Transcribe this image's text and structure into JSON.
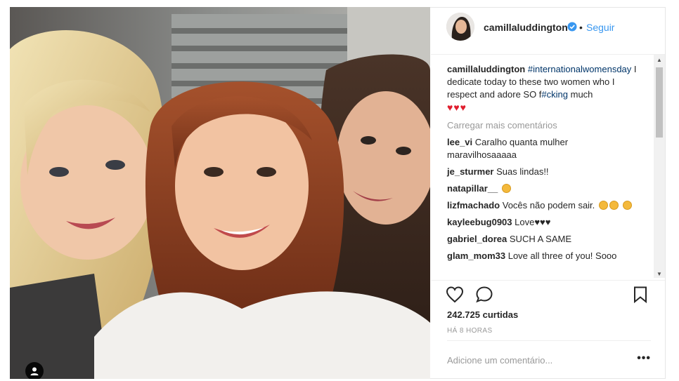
{
  "post": {
    "username": "camillaluddington",
    "follow_label": "Seguir",
    "separator": "•",
    "caption": {
      "username": "camillaluddington",
      "hashtag": "#internationalwomensday",
      "text": " I dedicate today to these two women who I respect and adore SO f",
      "tag2": "#cking",
      "text2": " much",
      "hearts": "♥♥♥"
    },
    "load_more": "Carregar mais comentários",
    "comments": [
      {
        "user": "lee_vi",
        "text": "Caralho quanta mulher maravilhosaaaaa"
      },
      {
        "user": "je_sturmer",
        "text": "Suas lindas!!"
      },
      {
        "user": "natapillar__",
        "text": ""
      },
      {
        "user": "lizfmachado",
        "text": "Vocês não podem sair."
      },
      {
        "user": "kayleebug0903",
        "text": "Love♥♥♥"
      },
      {
        "user": "gabriel_dorea",
        "text": "SUCH A SAME"
      },
      {
        "user": "glam_mom33",
        "text": "Love all three of you! Sooo"
      }
    ],
    "likes": "242.725 curtidas",
    "time": "HÁ 8 HORAS",
    "add_comment_placeholder": "Adicione um comentário...",
    "more_label": "•••",
    "colors": {
      "link": "#3897f0",
      "hashtag": "#003569",
      "muted": "#999999",
      "heart": "#e01e2e"
    },
    "icons": [
      "heart-icon",
      "comment-icon",
      "bookmark-icon",
      "verified-icon",
      "user-tag-icon"
    ]
  }
}
